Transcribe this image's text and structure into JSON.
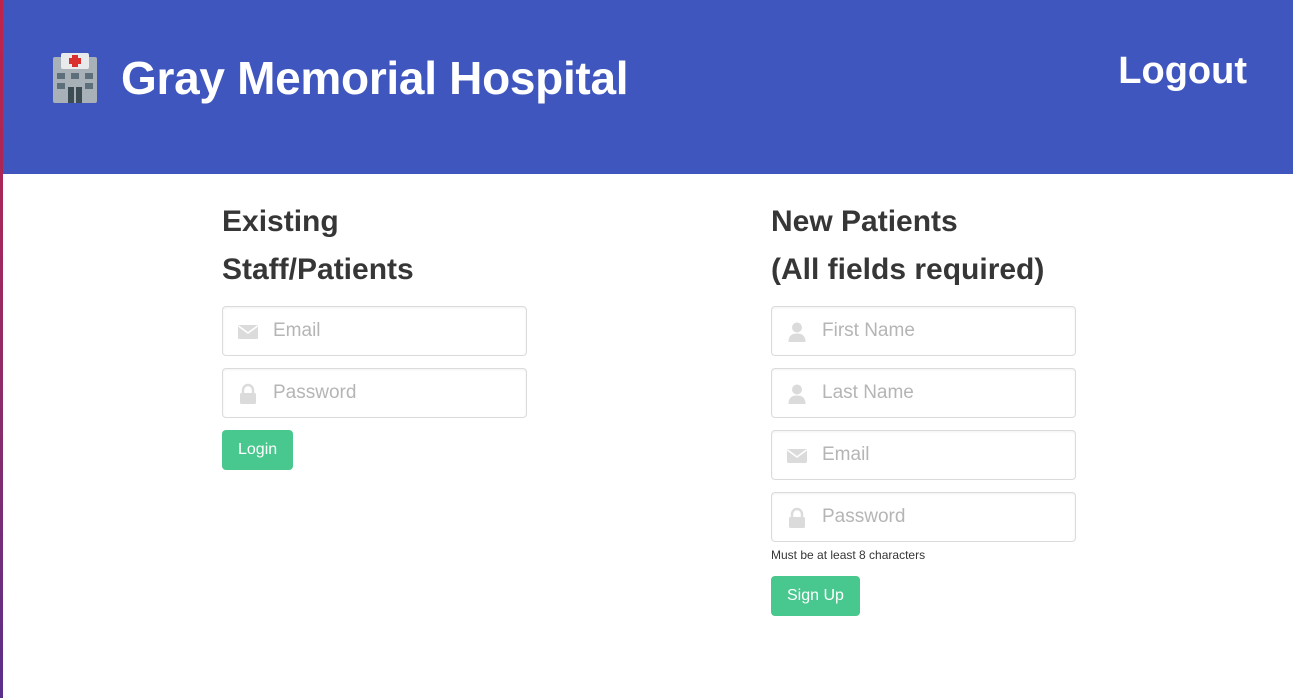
{
  "header": {
    "title": "Gray Memorial Hospital",
    "logout_label": "Logout",
    "background": "#3f56be"
  },
  "login": {
    "heading_line1": "Existing",
    "heading_line2": "Staff/Patients",
    "email_placeholder": "Email",
    "email_icon": "envelope-icon",
    "password_placeholder": "Password",
    "password_icon": "lock-icon",
    "submit_label": "Login"
  },
  "signup": {
    "heading_line1": "New Patients",
    "heading_line2": "(All fields required)",
    "first_name_placeholder": "First Name",
    "last_name_placeholder": "Last Name",
    "email_placeholder": "Email",
    "password_placeholder": "Password",
    "password_help": "Must be at least 8 characters",
    "submit_label": "Sign Up",
    "person_icon": "user-icon"
  },
  "colors": {
    "primary_button": "#48c78e",
    "icon_gray": "#dbdbdb"
  }
}
